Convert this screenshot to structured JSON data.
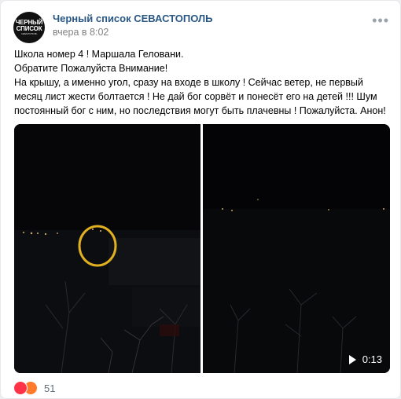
{
  "post": {
    "author": "Черный список СЕВАСТОПОЛЬ",
    "time": "вчера в 8:02",
    "avatar_lines": [
      "ЧЕРНЫЙ",
      "СПИСОК"
    ],
    "avatar_small": "СЕВАСТОПОЛЬ",
    "more_icon": "more-horizontal-icon",
    "text": [
      "Школа номер 4 ! Маршала Геловани.",
      "Обратите Пожалуйста Внимание!",
      "На крышу, а именно угол, сразу на входе в школу ! Сейчас ветер, не первый месяц лист жести болтается ! Не дай бог сорвёт и понесёт его на детей !!! Шум постоянный бог с ним, но последствия могут быть плачевны ! Пожалуйста. Анон!"
    ],
    "video_duration": "0:13",
    "reactions": {
      "count": "51",
      "icons": [
        "heart-icon",
        "angry-icon"
      ]
    },
    "colors": {
      "author": "#2a5885",
      "highlight_circle": "#e0b020"
    }
  }
}
